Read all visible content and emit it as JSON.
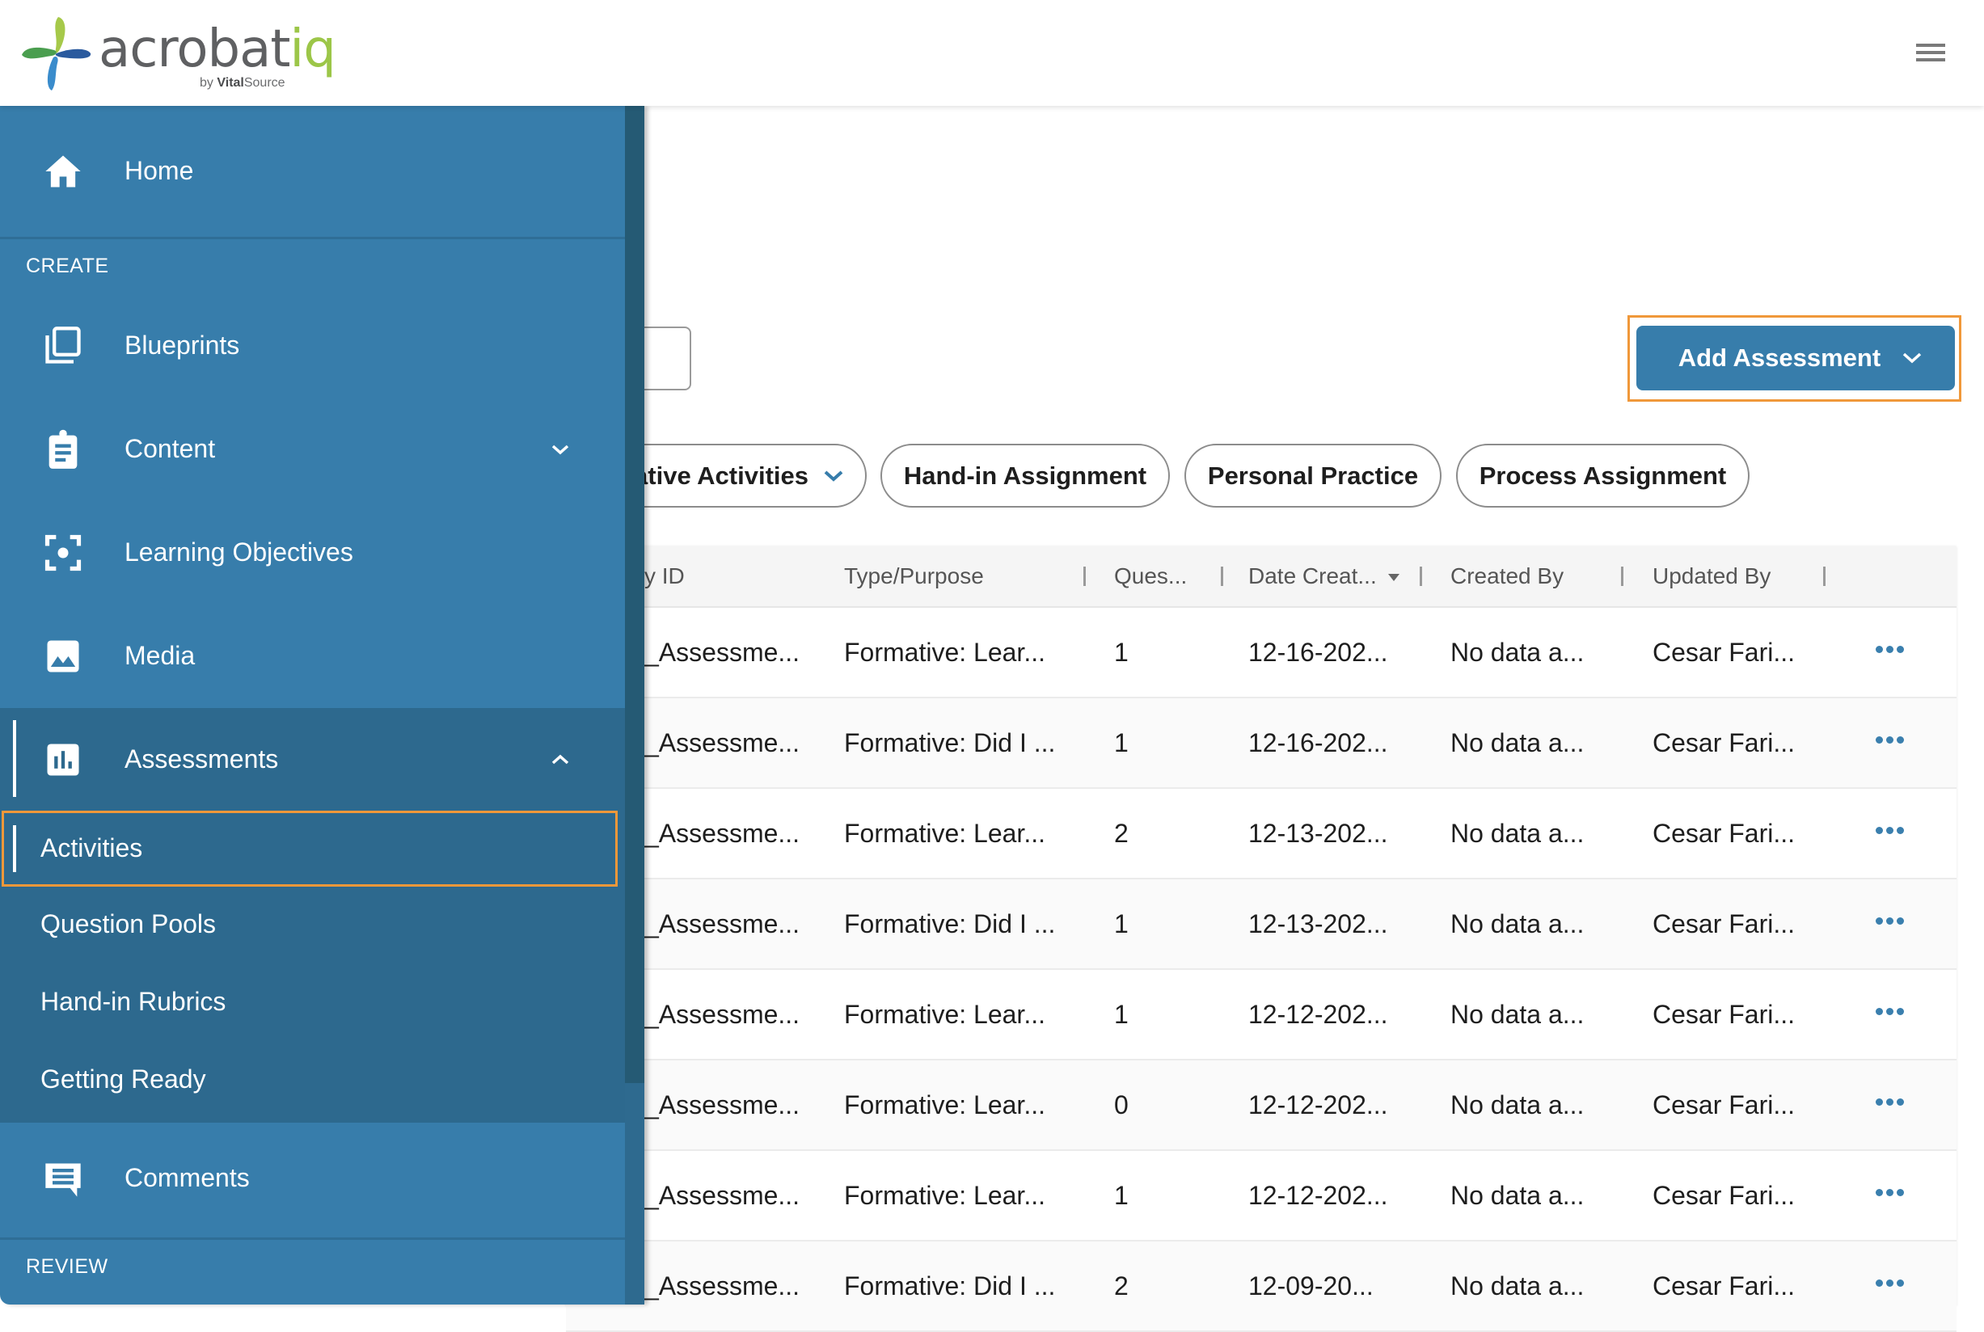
{
  "app": {
    "logo_text_main": "acrobat",
    "logo_text_accent": "iq",
    "logo_by": "by",
    "logo_vendor_bold": "Vital",
    "logo_vendor_rest": "Source",
    "menu_icon": "hamburger-menu-icon"
  },
  "sidebar": {
    "home": {
      "label": "Home",
      "icon": "home-icon"
    },
    "sections": {
      "create": "CREATE",
      "review": "REVIEW"
    },
    "items": [
      {
        "label": "Blueprints",
        "icon": "blueprints-icon"
      },
      {
        "label": "Content",
        "icon": "clipboard-icon",
        "expandable": true,
        "expanded": false
      },
      {
        "label": "Learning Objectives",
        "icon": "target-icon"
      },
      {
        "label": "Media",
        "icon": "image-icon"
      },
      {
        "label": "Assessments",
        "icon": "bar-chart-icon",
        "expandable": true,
        "expanded": true
      },
      {
        "label": "Comments",
        "icon": "comment-icon"
      }
    ],
    "assessments_sub": [
      {
        "label": "Activities",
        "active": true
      },
      {
        "label": "Question Pools"
      },
      {
        "label": "Hand-in Rubrics"
      },
      {
        "label": "Getting Ready"
      }
    ]
  },
  "main": {
    "search": {
      "value": ""
    },
    "add_button": {
      "label": "Add Assessment"
    },
    "filters": [
      {
        "label": "ative Activities",
        "has_dropdown": true
      },
      {
        "label": "Hand-in Assignment"
      },
      {
        "label": "Personal Practice"
      },
      {
        "label": "Process Assignment"
      }
    ],
    "table": {
      "columns": [
        "y ID",
        "Type/Purpose",
        "Ques...",
        "Date Creat...",
        "Created By",
        "Updated By"
      ],
      "sorted_column": "Date Creat...",
      "rows": [
        {
          "id": "_Assessme...",
          "type": "Formative: Lear...",
          "questions": "1",
          "date": "12-16-202...",
          "created_by": "No data a...",
          "updated_by": "Cesar Fari..."
        },
        {
          "id": "_Assessme...",
          "type": "Formative: Did I ...",
          "questions": "1",
          "date": "12-16-202...",
          "created_by": "No data a...",
          "updated_by": "Cesar Fari..."
        },
        {
          "id": "_Assessme...",
          "type": "Formative: Lear...",
          "questions": "2",
          "date": "12-13-202...",
          "created_by": "No data a...",
          "updated_by": "Cesar Fari..."
        },
        {
          "id": "_Assessme...",
          "type": "Formative: Did I ...",
          "questions": "1",
          "date": "12-13-202...",
          "created_by": "No data a...",
          "updated_by": "Cesar Fari..."
        },
        {
          "id": "_Assessme...",
          "type": "Formative: Lear...",
          "questions": "1",
          "date": "12-12-202...",
          "created_by": "No data a...",
          "updated_by": "Cesar Fari..."
        },
        {
          "id": "_Assessme...",
          "type": "Formative: Lear...",
          "questions": "0",
          "date": "12-12-202...",
          "created_by": "No data a...",
          "updated_by": "Cesar Fari..."
        },
        {
          "id": "_Assessme...",
          "type": "Formative: Lear...",
          "questions": "1",
          "date": "12-12-202...",
          "created_by": "No data a...",
          "updated_by": "Cesar Fari..."
        },
        {
          "id": "_Assessme...",
          "type": "Formative: Did I ...",
          "questions": "2",
          "date": "12-09-20...",
          "created_by": "No data a...",
          "updated_by": "Cesar Fari..."
        }
      ]
    }
  },
  "colors": {
    "sidebar_bg": "#377dab",
    "sidebar_sub_bg": "#2d698e",
    "primary_button": "#377dab",
    "highlight_outline": "#f0983a",
    "logo_green": "#9cc648"
  }
}
